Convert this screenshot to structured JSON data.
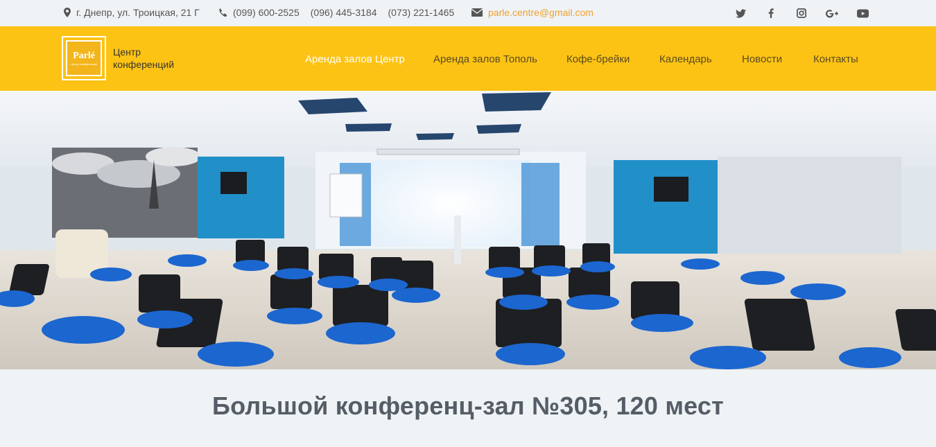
{
  "topbar": {
    "address": "г. Днепр, ул. Троицкая, 21 Г",
    "phones": [
      "(099) 600-2525",
      "(096) 445-3184",
      "(073) 221-1465"
    ],
    "email": "parle.centre@gmail.com",
    "icons": [
      "map-marker-icon",
      "phone-icon",
      "envelope-icon"
    ],
    "social": [
      "twitter-icon",
      "facebook-icon",
      "instagram-icon",
      "google-plus-icon",
      "youtube-icon"
    ]
  },
  "header": {
    "logo_text": "Parlé",
    "logo_sub": "Центр конференций",
    "brand_line1": "Центр",
    "brand_line2": "конференций",
    "nav": [
      {
        "label": "Аренда залов Центр",
        "active": true
      },
      {
        "label": "Аренда залов Тополь",
        "active": false
      },
      {
        "label": "Кофе-брейки",
        "active": false
      },
      {
        "label": "Календарь",
        "active": false
      },
      {
        "label": "Новости",
        "active": false
      },
      {
        "label": "Контакты",
        "active": false
      }
    ],
    "colors": {
      "bar": "#fdc314",
      "active_link": "#ffffff",
      "link": "#5a4a20"
    }
  },
  "hero": {
    "image": "conference-hall-photo",
    "title": "Большой конференц-зал №305, 120 мест"
  }
}
